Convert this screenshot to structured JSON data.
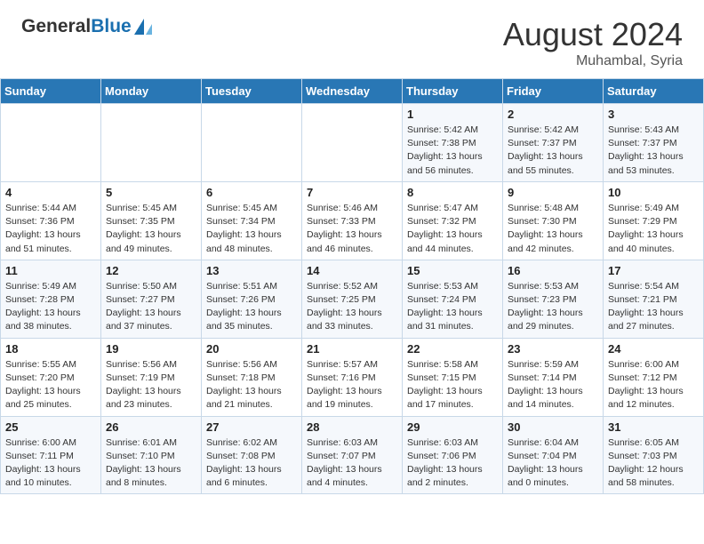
{
  "header": {
    "logo_line1": "General",
    "logo_line2": "Blue",
    "month_year": "August 2024",
    "location": "Muhambal, Syria"
  },
  "weekdays": [
    "Sunday",
    "Monday",
    "Tuesday",
    "Wednesday",
    "Thursday",
    "Friday",
    "Saturday"
  ],
  "weeks": [
    [
      {
        "day": "",
        "info": ""
      },
      {
        "day": "",
        "info": ""
      },
      {
        "day": "",
        "info": ""
      },
      {
        "day": "",
        "info": ""
      },
      {
        "day": "1",
        "info": "Sunrise: 5:42 AM\nSunset: 7:38 PM\nDaylight: 13 hours\nand 56 minutes."
      },
      {
        "day": "2",
        "info": "Sunrise: 5:42 AM\nSunset: 7:37 PM\nDaylight: 13 hours\nand 55 minutes."
      },
      {
        "day": "3",
        "info": "Sunrise: 5:43 AM\nSunset: 7:37 PM\nDaylight: 13 hours\nand 53 minutes."
      }
    ],
    [
      {
        "day": "4",
        "info": "Sunrise: 5:44 AM\nSunset: 7:36 PM\nDaylight: 13 hours\nand 51 minutes."
      },
      {
        "day": "5",
        "info": "Sunrise: 5:45 AM\nSunset: 7:35 PM\nDaylight: 13 hours\nand 49 minutes."
      },
      {
        "day": "6",
        "info": "Sunrise: 5:45 AM\nSunset: 7:34 PM\nDaylight: 13 hours\nand 48 minutes."
      },
      {
        "day": "7",
        "info": "Sunrise: 5:46 AM\nSunset: 7:33 PM\nDaylight: 13 hours\nand 46 minutes."
      },
      {
        "day": "8",
        "info": "Sunrise: 5:47 AM\nSunset: 7:32 PM\nDaylight: 13 hours\nand 44 minutes."
      },
      {
        "day": "9",
        "info": "Sunrise: 5:48 AM\nSunset: 7:30 PM\nDaylight: 13 hours\nand 42 minutes."
      },
      {
        "day": "10",
        "info": "Sunrise: 5:49 AM\nSunset: 7:29 PM\nDaylight: 13 hours\nand 40 minutes."
      }
    ],
    [
      {
        "day": "11",
        "info": "Sunrise: 5:49 AM\nSunset: 7:28 PM\nDaylight: 13 hours\nand 38 minutes."
      },
      {
        "day": "12",
        "info": "Sunrise: 5:50 AM\nSunset: 7:27 PM\nDaylight: 13 hours\nand 37 minutes."
      },
      {
        "day": "13",
        "info": "Sunrise: 5:51 AM\nSunset: 7:26 PM\nDaylight: 13 hours\nand 35 minutes."
      },
      {
        "day": "14",
        "info": "Sunrise: 5:52 AM\nSunset: 7:25 PM\nDaylight: 13 hours\nand 33 minutes."
      },
      {
        "day": "15",
        "info": "Sunrise: 5:53 AM\nSunset: 7:24 PM\nDaylight: 13 hours\nand 31 minutes."
      },
      {
        "day": "16",
        "info": "Sunrise: 5:53 AM\nSunset: 7:23 PM\nDaylight: 13 hours\nand 29 minutes."
      },
      {
        "day": "17",
        "info": "Sunrise: 5:54 AM\nSunset: 7:21 PM\nDaylight: 13 hours\nand 27 minutes."
      }
    ],
    [
      {
        "day": "18",
        "info": "Sunrise: 5:55 AM\nSunset: 7:20 PM\nDaylight: 13 hours\nand 25 minutes."
      },
      {
        "day": "19",
        "info": "Sunrise: 5:56 AM\nSunset: 7:19 PM\nDaylight: 13 hours\nand 23 minutes."
      },
      {
        "day": "20",
        "info": "Sunrise: 5:56 AM\nSunset: 7:18 PM\nDaylight: 13 hours\nand 21 minutes."
      },
      {
        "day": "21",
        "info": "Sunrise: 5:57 AM\nSunset: 7:16 PM\nDaylight: 13 hours\nand 19 minutes."
      },
      {
        "day": "22",
        "info": "Sunrise: 5:58 AM\nSunset: 7:15 PM\nDaylight: 13 hours\nand 17 minutes."
      },
      {
        "day": "23",
        "info": "Sunrise: 5:59 AM\nSunset: 7:14 PM\nDaylight: 13 hours\nand 14 minutes."
      },
      {
        "day": "24",
        "info": "Sunrise: 6:00 AM\nSunset: 7:12 PM\nDaylight: 13 hours\nand 12 minutes."
      }
    ],
    [
      {
        "day": "25",
        "info": "Sunrise: 6:00 AM\nSunset: 7:11 PM\nDaylight: 13 hours\nand 10 minutes."
      },
      {
        "day": "26",
        "info": "Sunrise: 6:01 AM\nSunset: 7:10 PM\nDaylight: 13 hours\nand 8 minutes."
      },
      {
        "day": "27",
        "info": "Sunrise: 6:02 AM\nSunset: 7:08 PM\nDaylight: 13 hours\nand 6 minutes."
      },
      {
        "day": "28",
        "info": "Sunrise: 6:03 AM\nSunset: 7:07 PM\nDaylight: 13 hours\nand 4 minutes."
      },
      {
        "day": "29",
        "info": "Sunrise: 6:03 AM\nSunset: 7:06 PM\nDaylight: 13 hours\nand 2 minutes."
      },
      {
        "day": "30",
        "info": "Sunrise: 6:04 AM\nSunset: 7:04 PM\nDaylight: 13 hours\nand 0 minutes."
      },
      {
        "day": "31",
        "info": "Sunrise: 6:05 AM\nSunset: 7:03 PM\nDaylight: 12 hours\nand 58 minutes."
      }
    ]
  ]
}
